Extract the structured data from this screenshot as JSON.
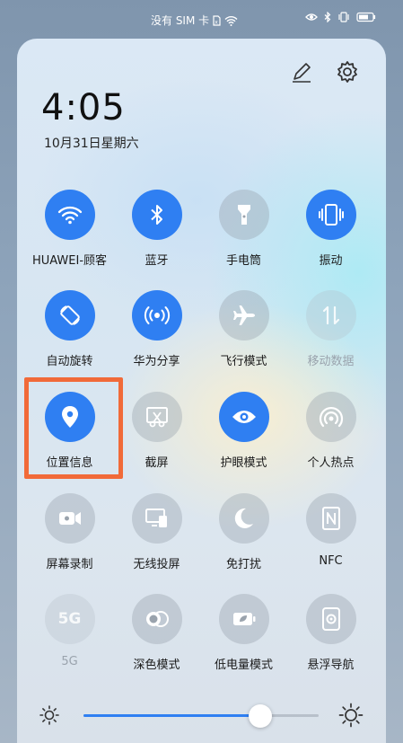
{
  "status_bar": {
    "carrier": "没有 SIM 卡",
    "icons": [
      "sim-icon",
      "wifi-icon",
      "eye-icon",
      "bluetooth-icon",
      "vibrate-icon",
      "battery-icon"
    ]
  },
  "header": {
    "time": "4:05",
    "date": "10月31日星期六",
    "edit_icon": "pencil-icon",
    "settings_icon": "gear-icon"
  },
  "tiles": [
    {
      "label": "HUAWEI-顾客",
      "icon": "wifi-icon",
      "state": "on"
    },
    {
      "label": "蓝牙",
      "icon": "bluetooth-icon",
      "state": "on"
    },
    {
      "label": "手电筒",
      "icon": "flashlight-icon",
      "state": "off"
    },
    {
      "label": "振动",
      "icon": "vibrate-icon",
      "state": "on"
    },
    {
      "label": "自动旋转",
      "icon": "auto-rotate-icon",
      "state": "on"
    },
    {
      "label": "华为分享",
      "icon": "huawei-share-icon",
      "state": "on"
    },
    {
      "label": "飞行模式",
      "icon": "airplane-icon",
      "state": "off"
    },
    {
      "label": "移动数据",
      "icon": "mobile-data-icon",
      "state": "disabled"
    },
    {
      "label": "位置信息",
      "icon": "location-icon",
      "state": "on"
    },
    {
      "label": "截屏",
      "icon": "screenshot-icon",
      "state": "off"
    },
    {
      "label": "护眼模式",
      "icon": "eye-comfort-icon",
      "state": "on"
    },
    {
      "label": "个人热点",
      "icon": "hotspot-icon",
      "state": "off"
    },
    {
      "label": "屏幕录制",
      "icon": "screen-record-icon",
      "state": "off"
    },
    {
      "label": "无线投屏",
      "icon": "wireless-projection-icon",
      "state": "off"
    },
    {
      "label": "免打扰",
      "icon": "moon-icon",
      "state": "off"
    },
    {
      "label": "NFC",
      "icon": "nfc-icon",
      "state": "off"
    },
    {
      "label": "5G",
      "icon": "5g-icon",
      "state": "disabled"
    },
    {
      "label": "深色模式",
      "icon": "dark-mode-icon",
      "state": "off"
    },
    {
      "label": "低电量模式",
      "icon": "battery-saver-icon",
      "state": "off"
    },
    {
      "label": "悬浮导航",
      "icon": "floating-navigation-icon",
      "state": "off"
    }
  ],
  "icon_5g_text": "5G",
  "brightness": {
    "level": 0.75,
    "low_icon": "brightness-low-icon",
    "high_icon": "brightness-high-icon"
  },
  "colors": {
    "accent": "#2f7ff2",
    "highlight": "#f16a39"
  }
}
